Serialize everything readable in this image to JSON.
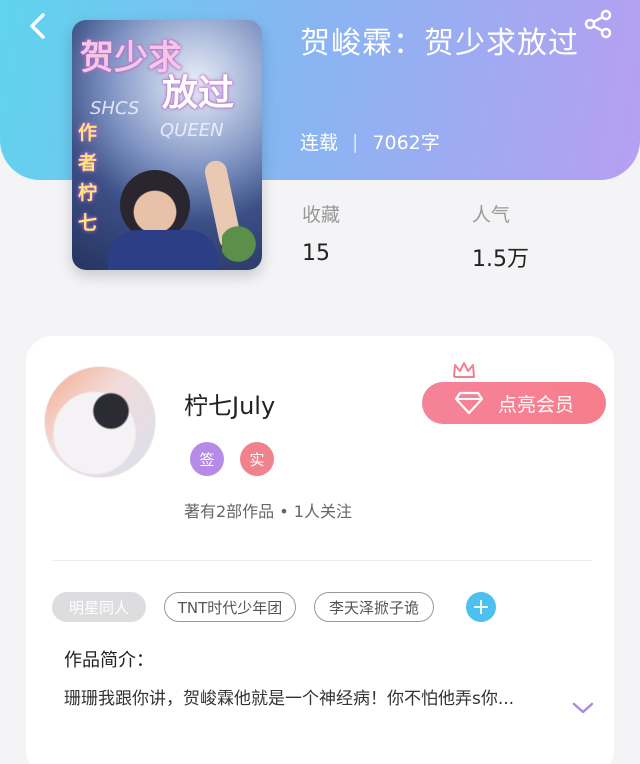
{
  "book": {
    "title": "贺峻霖：贺少求放过",
    "status": "连载",
    "word_count": "7062字",
    "favorites_label": "收藏",
    "favorites": "15",
    "popularity_label": "人气",
    "popularity": "1.5万",
    "cover_text": {
      "title_line1": "贺少求",
      "title_line2": "放过",
      "author_credit": "作者柠七",
      "script_1": "SHCS",
      "script_2": "QUEEN"
    }
  },
  "author": {
    "name": "柠七July",
    "badges": [
      {
        "text": "签",
        "color": "#b58be8"
      },
      {
        "text": "实",
        "color": "#f0828e"
      }
    ],
    "stats": "著有2部作品 • 1人关注",
    "vip_button": "点亮会员"
  },
  "tags": [
    "明星同人",
    "TNT时代少年团",
    "李天泽掀子诡"
  ],
  "add_tag": "+",
  "intro": {
    "heading": "作品简介：",
    "text": "珊珊我跟你讲，贺峻霖他就是一个神经病！你不怕他弄s你..."
  },
  "icons": {
    "back": "back-arrow-icon",
    "share": "share-icon",
    "crown": "crown-icon",
    "diamond": "diamond-icon",
    "expand": "chevron-down-icon"
  },
  "colors": {
    "header_start": "#5fd4ee",
    "header_end": "#b79ff1",
    "vip": "#f77d8c",
    "add_tag": "#4dc0f0"
  }
}
